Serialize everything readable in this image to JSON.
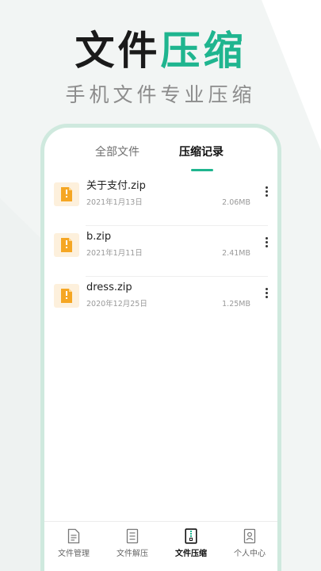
{
  "promo": {
    "title_dark": "文件",
    "title_green": "压缩",
    "subtitle": "手机文件专业压缩"
  },
  "tabs": [
    {
      "label": "全部文件",
      "active": false
    },
    {
      "label": "压缩记录",
      "active": true
    }
  ],
  "files": [
    {
      "name": "关于支付.zip",
      "date": "2021年1月13日",
      "size": "2.06MB"
    },
    {
      "name": "b.zip",
      "date": "2021年1月11日",
      "size": "2.41MB"
    },
    {
      "name": "dress.zip",
      "date": "2020年12月25日",
      "size": "1.25MB"
    }
  ],
  "nav": [
    {
      "label": "文件管理",
      "icon": "document-icon",
      "active": false
    },
    {
      "label": "文件解压",
      "icon": "list-document-icon",
      "active": false
    },
    {
      "label": "文件压缩",
      "icon": "zip-file-icon",
      "active": true
    },
    {
      "label": "个人中心",
      "icon": "profile-card-icon",
      "active": false
    }
  ],
  "colors": {
    "accent": "#1fb58f",
    "frame": "#cfe9de",
    "background": "#f2f5f4",
    "file_icon_bg": "#fdf0dc",
    "file_icon_fg": "#f5a623"
  }
}
